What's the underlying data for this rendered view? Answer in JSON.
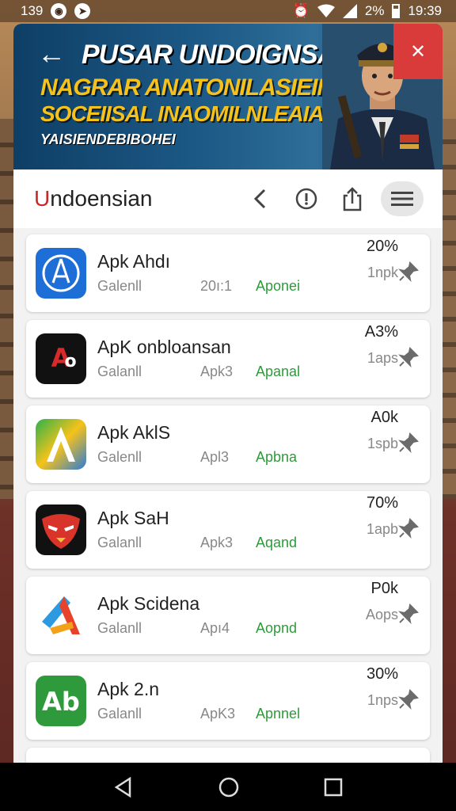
{
  "status": {
    "time_left": "139",
    "battery": "2%",
    "clock": "19:39"
  },
  "banner": {
    "title": "PUSAR UNDOIGNSAN",
    "line1": "NAGRAR ANATONILASIEIN",
    "line2": "SOCEIISAL INAOMILNLEAIAR",
    "line3": "YAISIENDEBIBOHEI"
  },
  "toolbar": {
    "app_name_first": "U",
    "app_name_rest": "ndoensian"
  },
  "items": [
    {
      "name": "Apk Ahdı",
      "meta1": "Galenll",
      "meta2": "20ı:1",
      "meta3": "Aponei",
      "pct": "20%",
      "apps": "1npk",
      "icon": "blue-compass-icon"
    },
    {
      "name": "ApK onbloansan",
      "meta1": "Galanll",
      "meta2": "Apk3",
      "meta3": "Apanal",
      "pct": "A3%",
      "apps": "1aps",
      "icon": "ao-logo-icon"
    },
    {
      "name": "Apk AklS",
      "meta1": "Galenll",
      "meta2": "Apl3",
      "meta3": "Apbna",
      "pct": "A0k",
      "apps": "1spb",
      "icon": "gradient-a-icon"
    },
    {
      "name": "Apk SaH",
      "meta1": "Galanll",
      "meta2": "Apk3",
      "meta3": "Aqand",
      "pct": "70%",
      "apps": "1apb",
      "icon": "mask-emblem-icon"
    },
    {
      "name": "Apk Scidena",
      "meta1": "Galanll",
      "meta2": "Apı4",
      "meta3": "Aopnd",
      "pct": "P0k",
      "apps": "Aops",
      "icon": "colorful-a-icon"
    },
    {
      "name": "Apk 2.n",
      "meta1": "Galanll",
      "meta2": "ApK3",
      "meta3": "Apnnel",
      "pct": "30%",
      "apps": "1nps",
      "icon": "green-ab-icon"
    }
  ]
}
